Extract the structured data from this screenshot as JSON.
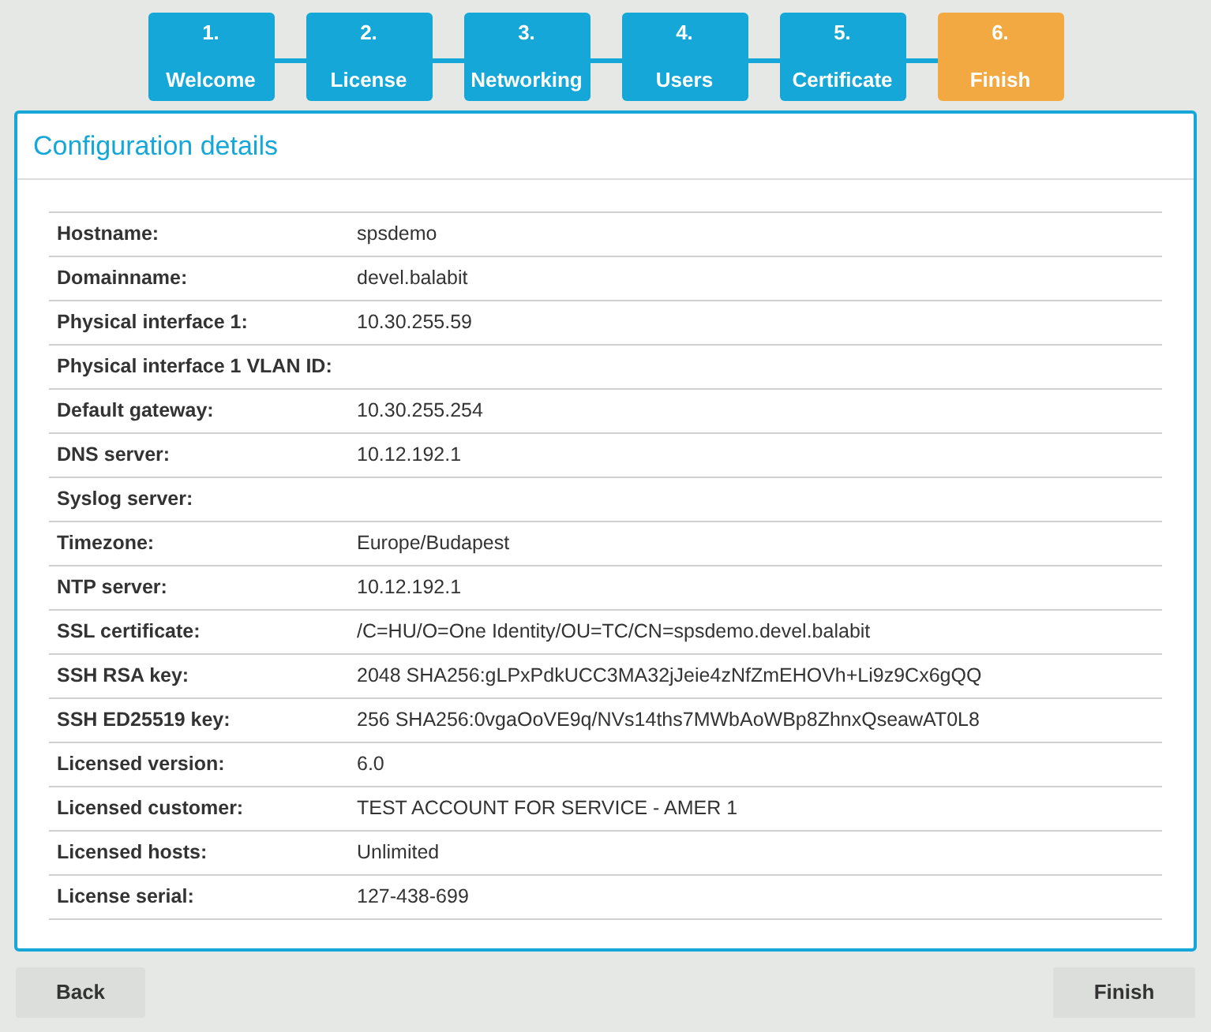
{
  "steps": [
    {
      "number": "1.",
      "label": "Welcome",
      "selected": false
    },
    {
      "number": "2.",
      "label": "License",
      "selected": false
    },
    {
      "number": "3.",
      "label": "Networking",
      "selected": false
    },
    {
      "number": "4.",
      "label": "Users",
      "selected": false
    },
    {
      "number": "5.",
      "label": "Certificate",
      "selected": false
    },
    {
      "number": "6.",
      "label": "Finish",
      "selected": true
    }
  ],
  "panel": {
    "title": "Configuration details",
    "rows": [
      {
        "label": "Hostname:",
        "value": "spsdemo"
      },
      {
        "label": "Domainname:",
        "value": "devel.balabit"
      },
      {
        "label": "Physical interface 1:",
        "value": "10.30.255.59"
      },
      {
        "label": "Physical interface 1 VLAN ID:"
      },
      {
        "label": "Default gateway:",
        "value": "10.30.255.254"
      },
      {
        "label": "DNS server:",
        "value": "10.12.192.1"
      },
      {
        "label": "Syslog server:"
      },
      {
        "label": "Timezone:",
        "value": "Europe/Budapest"
      },
      {
        "label": "NTP server:",
        "value": "10.12.192.1"
      },
      {
        "label": "SSL certificate:",
        "value": "/C=HU/O=One Identity/OU=TC/CN=spsdemo.devel.balabit"
      },
      {
        "label": "SSH RSA key:",
        "value": "2048 SHA256:gLPxPdkUCC3MA32jJeie4zNfZmEHOVh+Li9z9Cx6gQQ"
      },
      {
        "label": "SSH ED25519 key:",
        "value": "256 SHA256:0vgaOoVE9q/NVs14ths7MWbAoWBp8ZhnxQseawAT0L8"
      },
      {
        "label": "Licensed version:",
        "value": "6.0"
      },
      {
        "label": "Licensed customer:",
        "value": "TEST ACCOUNT FOR SERVICE - AMER 1"
      },
      {
        "label": "Licensed hosts:",
        "value": "Unlimited"
      },
      {
        "label": "License serial:",
        "value": "127-438-699"
      }
    ]
  },
  "buttons": {
    "back": "Back",
    "finish": "Finish"
  }
}
